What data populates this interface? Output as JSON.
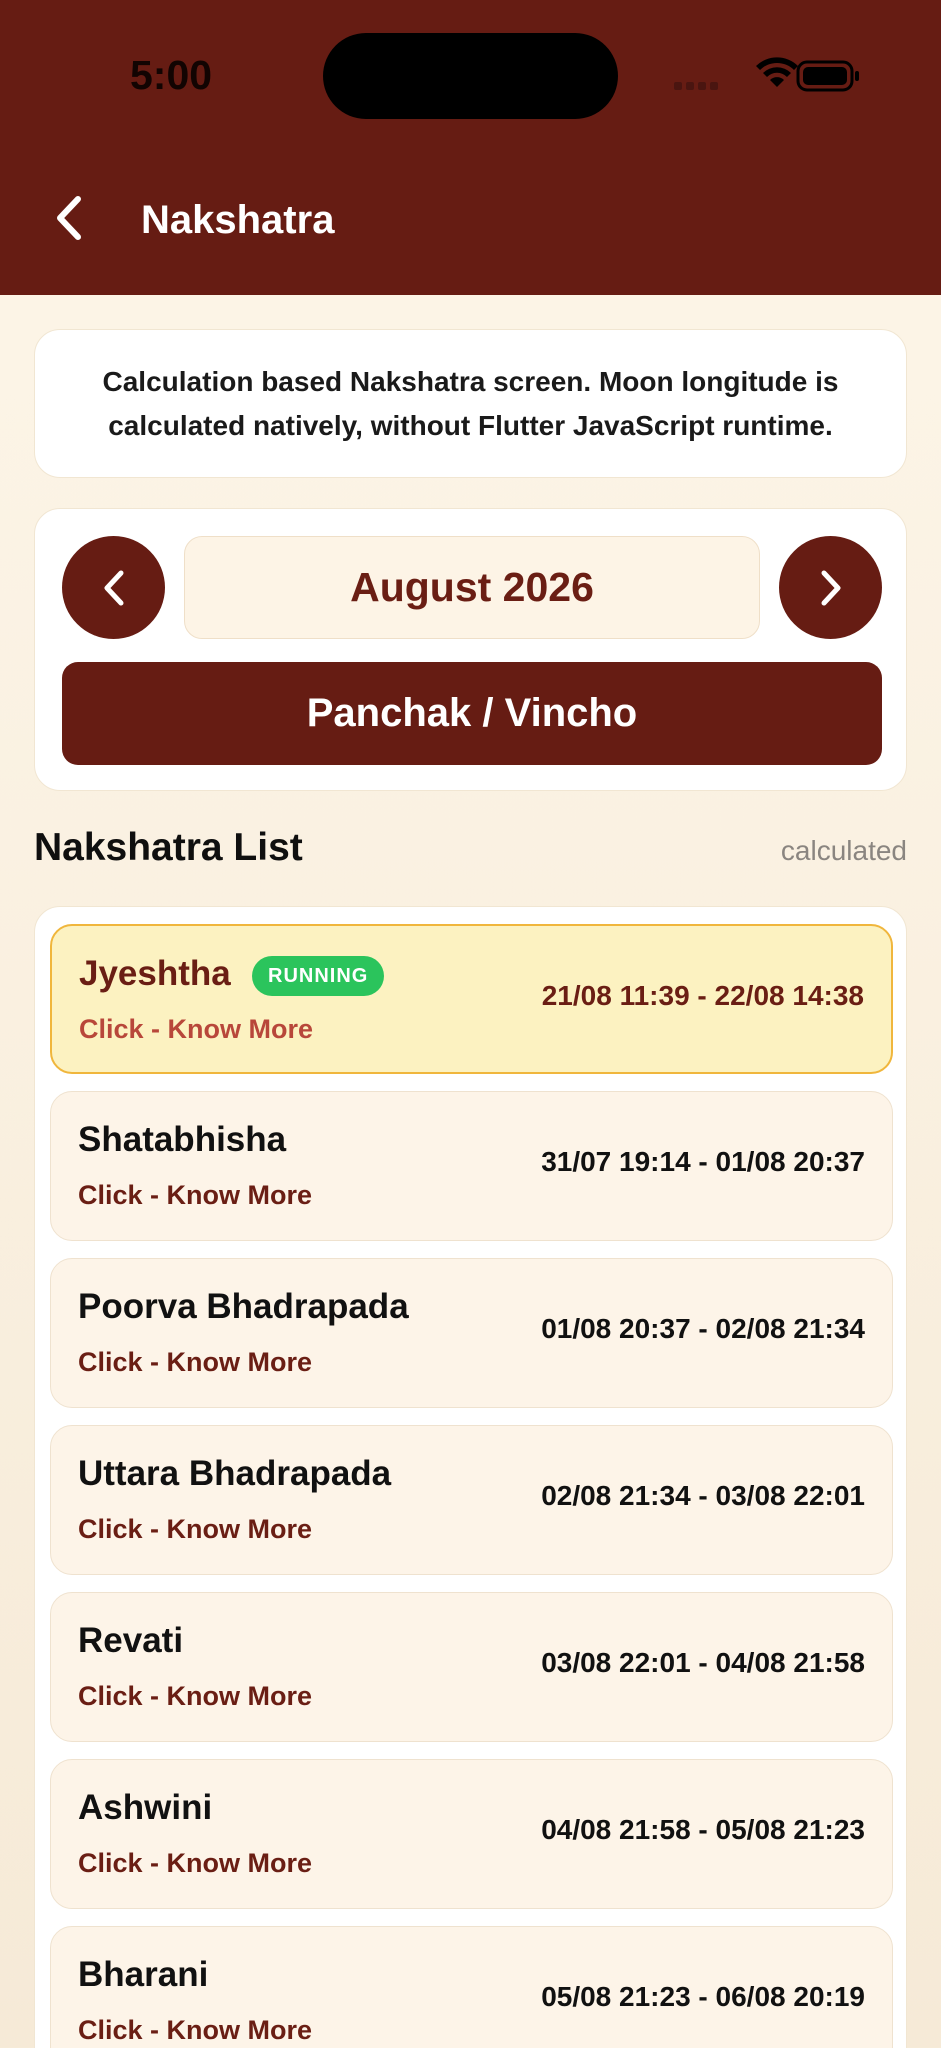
{
  "status_bar": {
    "time": "5:00"
  },
  "nav": {
    "title": "Nakshatra"
  },
  "info": {
    "text": "Calculation based Nakshatra screen. Moon longitude is calculated natively, without Flutter JavaScript runtime."
  },
  "month": {
    "label": "August 2026"
  },
  "panchak": {
    "label": "Panchak / Vincho"
  },
  "section": {
    "title": "Nakshatra List",
    "meta": "calculated"
  },
  "items": [
    {
      "name": "Jyeshtha",
      "link": "Click - Know More",
      "time": "21/08 11:39 - 22/08 14:38",
      "badge": "RUNNING"
    },
    {
      "name": "Shatabhisha",
      "link": "Click - Know More",
      "time": "31/07 19:14 - 01/08 20:37"
    },
    {
      "name": "Poorva Bhadrapada",
      "link": "Click - Know More",
      "time": "01/08 20:37 - 02/08 21:34"
    },
    {
      "name": "Uttara Bhadrapada",
      "link": "Click - Know More",
      "time": "02/08 21:34 - 03/08 22:01"
    },
    {
      "name": "Revati",
      "link": "Click - Know More",
      "time": "03/08 22:01 - 04/08 21:58"
    },
    {
      "name": "Ashwini",
      "link": "Click - Know More",
      "time": "04/08 21:58 - 05/08 21:23"
    },
    {
      "name": "Bharani",
      "link": "Click - Know More",
      "time": "05/08 21:23 - 06/08 20:19"
    }
  ],
  "colors": {
    "primary": "#661c13",
    "running_bg": "#fcf2c1",
    "running_border": "#f0b63c",
    "badge": "#2bc45c"
  }
}
